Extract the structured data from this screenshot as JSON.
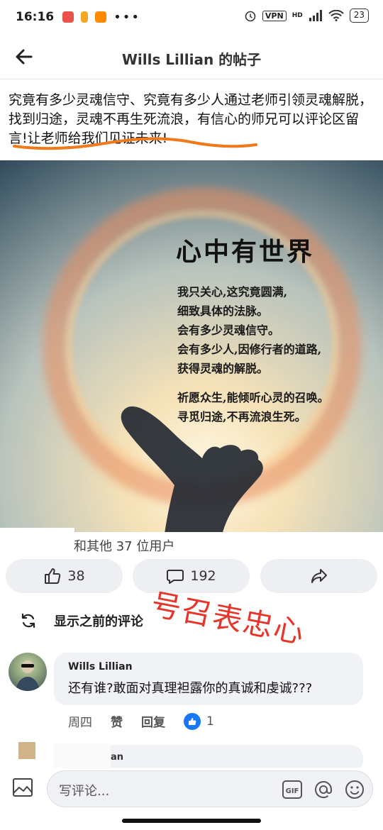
{
  "status_bar": {
    "time": "16:16",
    "dots": "•••",
    "vpn": "VPN",
    "network": "HD",
    "battery": "23"
  },
  "header": {
    "title": "Wills Lillian 的帖子"
  },
  "post": {
    "text": "究竟有多少灵魂信守、究竟有多少人通过老师引领灵魂解脱，找到归途，灵魂不再生死流浪，有信心的师兄可以评论区留言!让老师给我们见证未来!",
    "image": {
      "title": "心中有世界",
      "poem_lines": [
        "我只关心,这究竟圆满,",
        "细致具体的法脉。",
        "会有多少灵魂信守。",
        "会有多少人,因修行者的道路,",
        "获得灵魂的解脱。"
      ],
      "poem_lines_2": [
        "祈愿众生,能倾听心灵的召唤。",
        "寻觅归途,不再流浪生死。"
      ]
    },
    "reactors_text": "和其他 37 位用户",
    "like_count": "38",
    "comment_count": "192"
  },
  "annotation": {
    "stamp_text": "号召表忠心",
    "stamp_color": "#e8352b"
  },
  "comments_section": {
    "show_previous_label": "显示之前的评论",
    "comments": [
      {
        "author": "Wills Lillian",
        "body": "还有谁?敢面对真理袒露你的真诚和虔诚???",
        "time": "周四",
        "like_label": "赞",
        "reply_label": "回复",
        "reactions": "1"
      }
    ],
    "next_comment_author_fragment": "an"
  },
  "composer": {
    "placeholder": "写评论..."
  },
  "colors": {
    "accent": "#1877f2",
    "button_bg": "#eeeff2"
  }
}
